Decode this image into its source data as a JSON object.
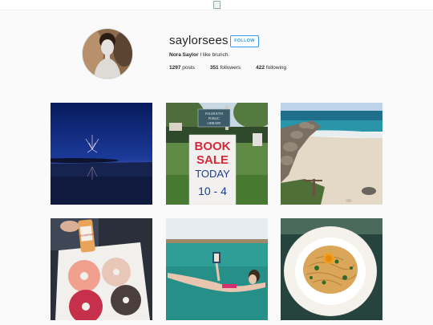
{
  "profile": {
    "username": "saylorsees",
    "follow_label": "FOLLOW",
    "full_name": "Nora Saylor",
    "bio": "I like brunch.",
    "stats": [
      {
        "count": "1297",
        "label": "posts"
      },
      {
        "count": "351",
        "label": "followers"
      },
      {
        "count": "422",
        "label": "following"
      }
    ]
  },
  "book_sign": {
    "line1": "BOOK",
    "line2": "SALE",
    "line3": "TODAY",
    "line4": "10 - 4",
    "library_sign": "FALMOUTH PUBLIC LIBRARY"
  },
  "drink_label": "BLACKBERRY",
  "posts": [
    {
      "subject": "fireworks-over-water"
    },
    {
      "subject": "book-sale-sign"
    },
    {
      "subject": "rocky-beach"
    },
    {
      "subject": "donuts-box"
    },
    {
      "subject": "floating-reader"
    },
    {
      "subject": "pasta-plate"
    }
  ]
}
